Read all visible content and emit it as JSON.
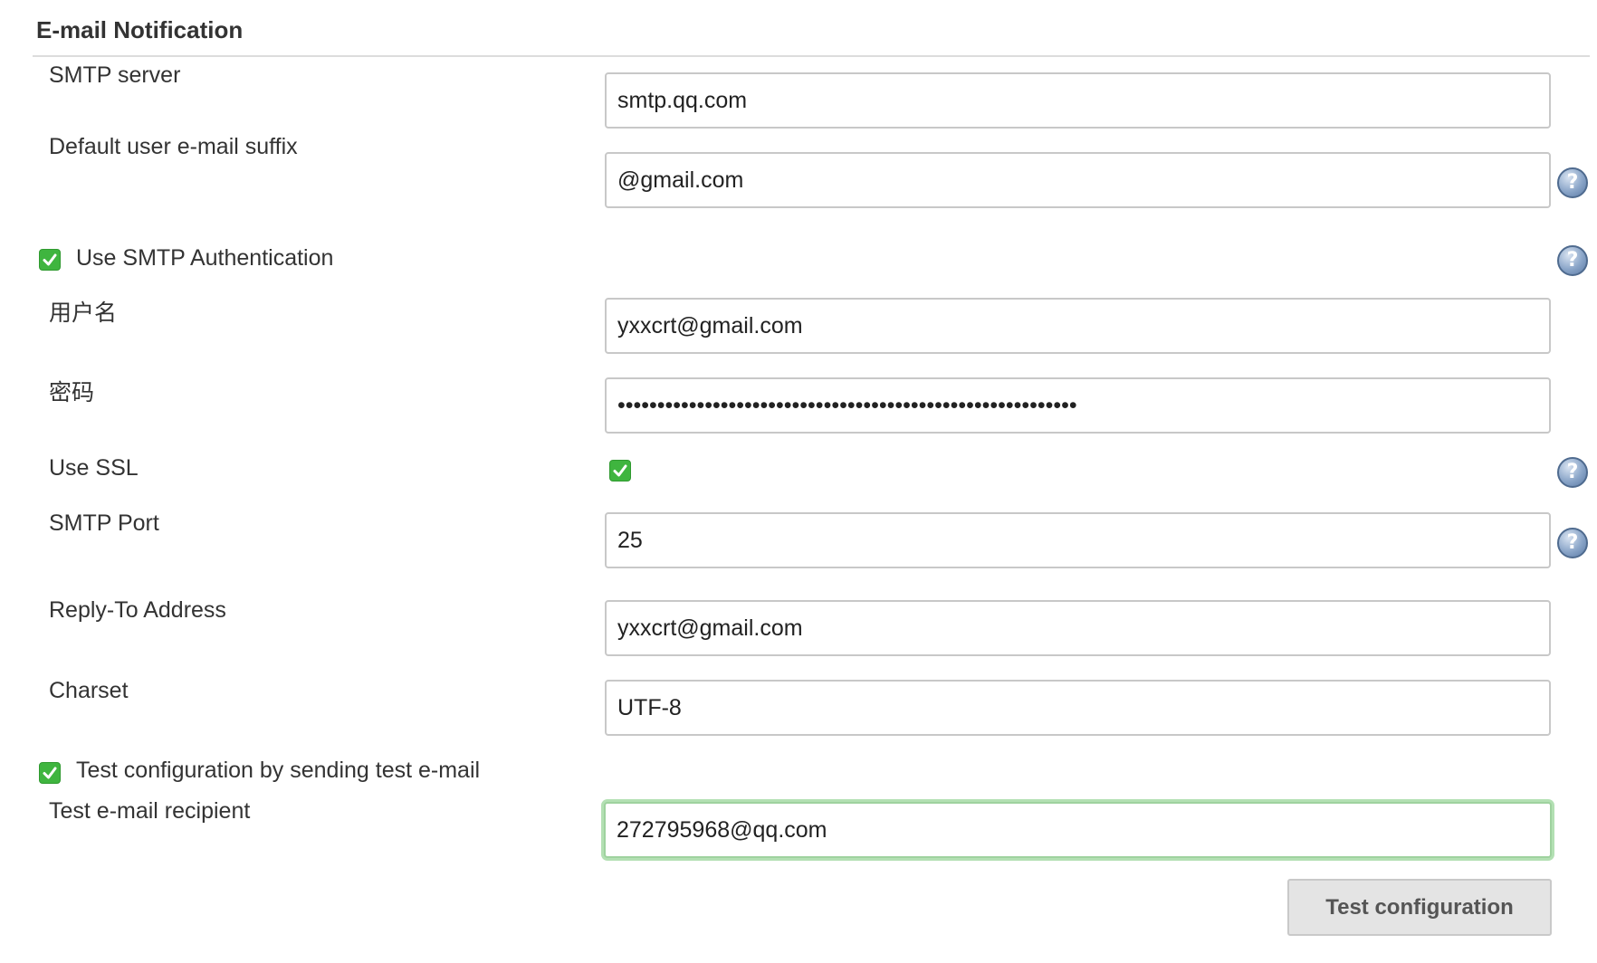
{
  "section": {
    "title": "E-mail Notification"
  },
  "smtp_server": {
    "label": "SMTP server",
    "value": "smtp.qq.com"
  },
  "default_suffix": {
    "label": "Default user e-mail suffix",
    "value": "@gmail.com"
  },
  "smtp_auth": {
    "label": "Use SMTP Authentication",
    "checked": true
  },
  "username": {
    "label": "用户名",
    "value": "yxxcrt@gmail.com"
  },
  "password": {
    "label": "密码",
    "masked_value": "••••••••••••••••••••••••••••••••••••••••••••••••••••••••••"
  },
  "use_ssl": {
    "label": "Use SSL",
    "checked": true
  },
  "smtp_port": {
    "label": "SMTP Port",
    "value": "25"
  },
  "reply_to": {
    "label": "Reply-To Address",
    "value": "yxxcrt@gmail.com"
  },
  "charset": {
    "label": "Charset",
    "value": "UTF-8"
  },
  "test_config": {
    "label": "Test configuration by sending test e-mail",
    "checked": true
  },
  "test_recipient": {
    "label": "Test e-mail recipient",
    "value": "272795968@qq.com"
  },
  "test_button": {
    "label": "Test configuration"
  },
  "colors": {
    "checkbox_green": "#3fb53f",
    "focus_ring": "#b3e0b3",
    "help_icon_blue": "#5b7aa5",
    "button_bg": "#e4e4e4"
  },
  "icons": {
    "help": "help-icon",
    "check": "checkmark-icon"
  }
}
